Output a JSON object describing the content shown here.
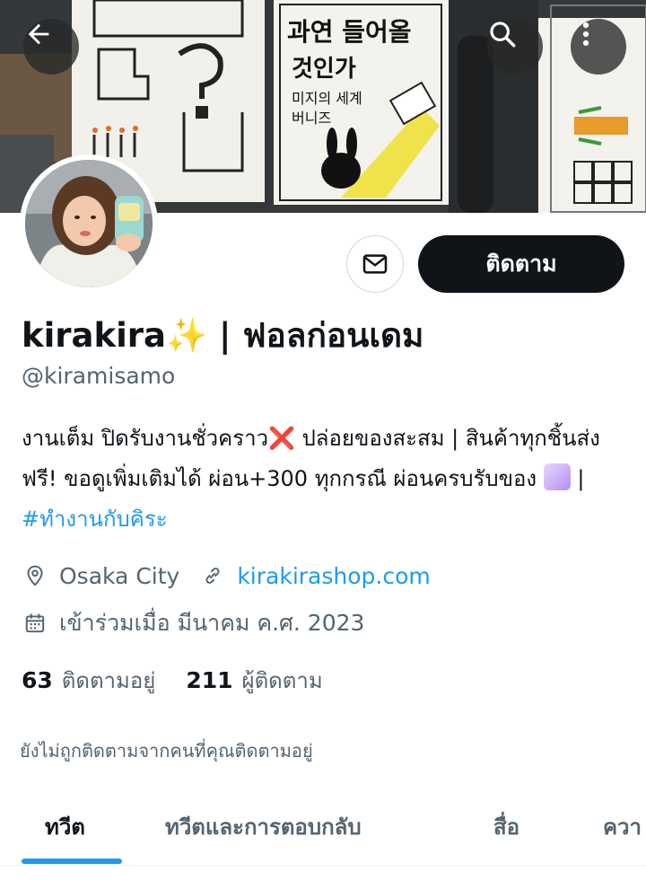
{
  "profile": {
    "display_name": "kirakira✨ | ฟอลก่อนเดม",
    "handle": "@kiramisamo",
    "bio_text": "งานเต็ม ปิดรับงานชั่วคราว❌ ปล่อยของสะสม | สินค้าทุกชิ้นส่งฟรี! ขอดูเพิ่มเติมได้ ผ่อน+300 ทุกกรณี ผ่อนครบรับของ",
    "bio_separator": " | ",
    "bio_hashtag": "#ทำงานกับคิระ",
    "location": "Osaka City",
    "website": "kirakirashop.com",
    "joined": "เข้าร่วมเมื่อ มีนาคม ค.ศ. 2023",
    "following_count": "63",
    "following_label": "ติดตามอยู่",
    "followers_count": "211",
    "followers_label": "ผู้ติดตาม",
    "not_followed_text": "ยังไม่ถูกติดตามจากคนที่คุณติดตามอยู่"
  },
  "actions": {
    "follow_label": "ติดตาม"
  },
  "banner_text": {
    "korean_line1": "과연 들어올",
    "korean_line2": "것인가",
    "korean_line3": "미지의 세계",
    "korean_line4": "버니즈"
  },
  "tabs": [
    {
      "label": "ทวีต",
      "active": true
    },
    {
      "label": "ทวีตและการตอบกลับ",
      "active": false
    },
    {
      "label": "สื่อ",
      "active": false
    },
    {
      "label": "ควา",
      "active": false
    }
  ],
  "icons": {
    "back": "arrow-left-icon",
    "search": "search-icon",
    "more": "more-vertical-icon",
    "message": "envelope-icon",
    "location": "location-pin-icon",
    "link": "link-icon",
    "calendar": "calendar-icon",
    "emoji": "purple-heart-emoji"
  },
  "colors": {
    "accent": "#1d9bf0",
    "text_primary": "#0f1419",
    "text_secondary": "#536471",
    "follow_button_bg": "#0f1419",
    "heart_emoji": "#c9a6f5"
  }
}
